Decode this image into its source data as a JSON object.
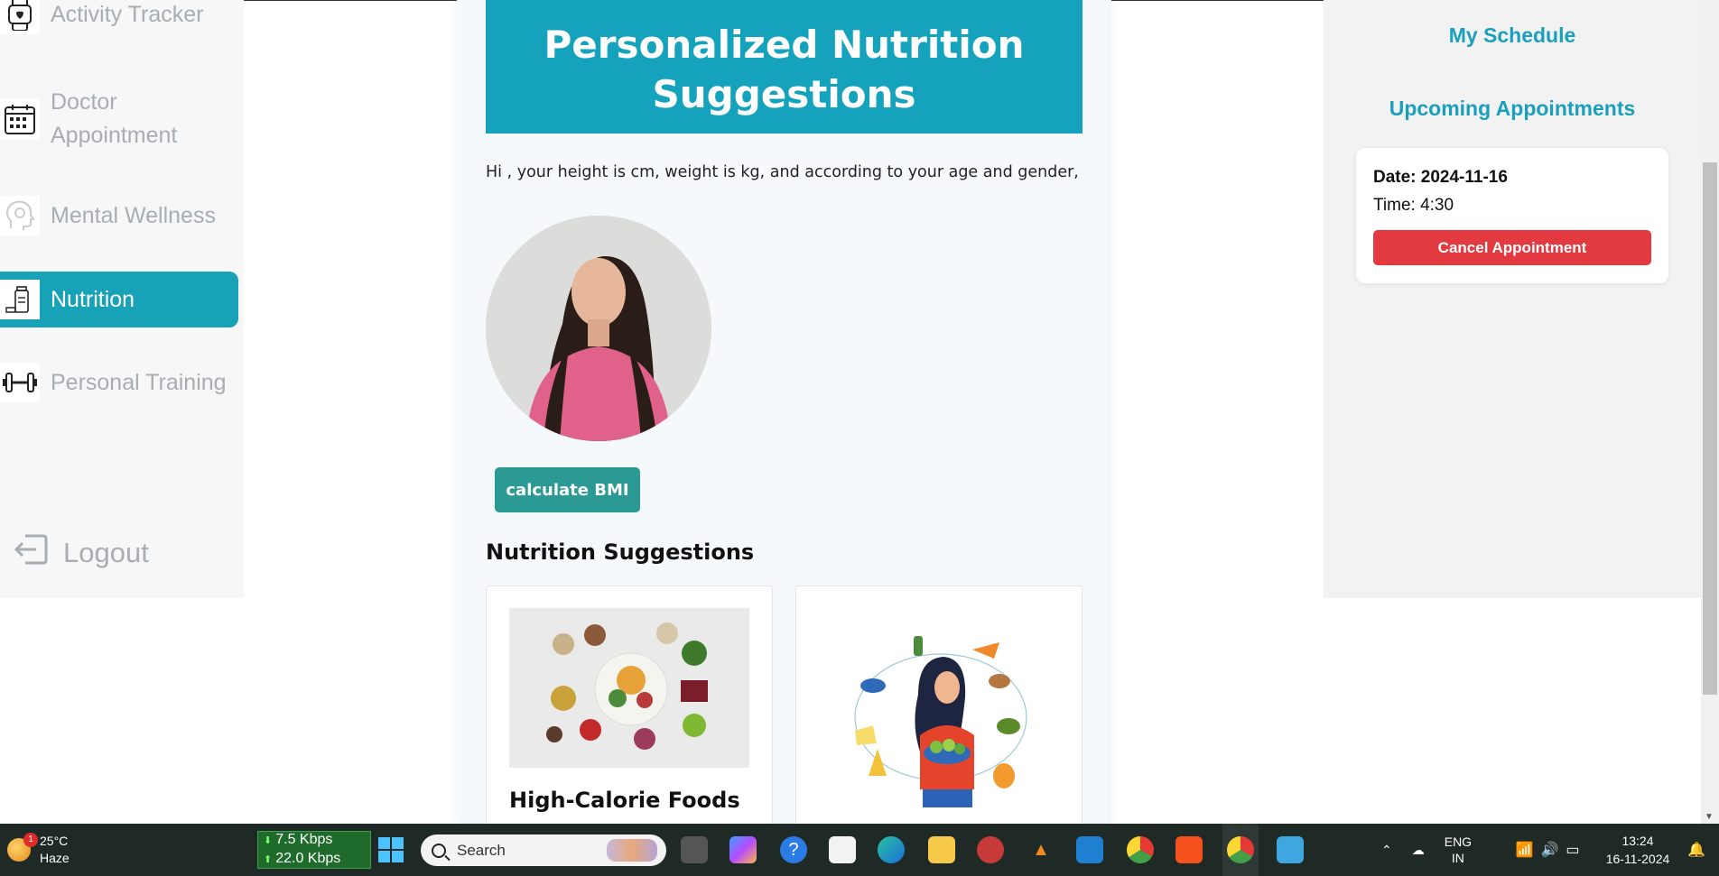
{
  "sidebar": {
    "items": [
      {
        "label": "Activity Tracker",
        "icon": "smartwatch-icon",
        "active": false
      },
      {
        "label": "Doctor Appointment",
        "icon": "calendar-icon",
        "active": false
      },
      {
        "label": "Mental Wellness",
        "icon": "head-icon",
        "active": false
      },
      {
        "label": "Nutrition",
        "icon": "supplement-bottle-icon",
        "active": true
      },
      {
        "label": "Personal Training",
        "icon": "dumbbell-icon",
        "active": false
      }
    ],
    "logout_label": "Logout"
  },
  "main": {
    "hero_title": "Personalized Nutrition Suggestions",
    "intro_text": "Hi , your height is cm, weight is kg, and according to your age and gender,",
    "bmi_button": "calculate BMI",
    "suggestions_title": "Nutrition Suggestions",
    "cards": [
      {
        "title": "High-Calorie Foods",
        "image": "healthy-food-platter"
      },
      {
        "title": "",
        "image": "woman-with-salad-illustration"
      }
    ]
  },
  "schedule": {
    "title": "My Schedule",
    "upcoming_title": "Upcoming Appointments",
    "appointment": {
      "date_label": "Date: 2024-11-16",
      "time_label": "Time: 4:30",
      "cancel_label": "Cancel Appointment"
    }
  },
  "taskbar": {
    "weather_temp": "25°C",
    "weather_desc": "Haze",
    "weather_badge": "1",
    "net_down": "7.5 Kbps",
    "net_up": "22.0 Kbps",
    "search_placeholder": "Search",
    "lang_line1": "ENG",
    "lang_line2": "IN",
    "time": "13:24",
    "date": "16-11-2024"
  },
  "colors": {
    "accent": "#17a2b8",
    "danger": "#e33a42",
    "bmi_button": "#2b9a94"
  }
}
